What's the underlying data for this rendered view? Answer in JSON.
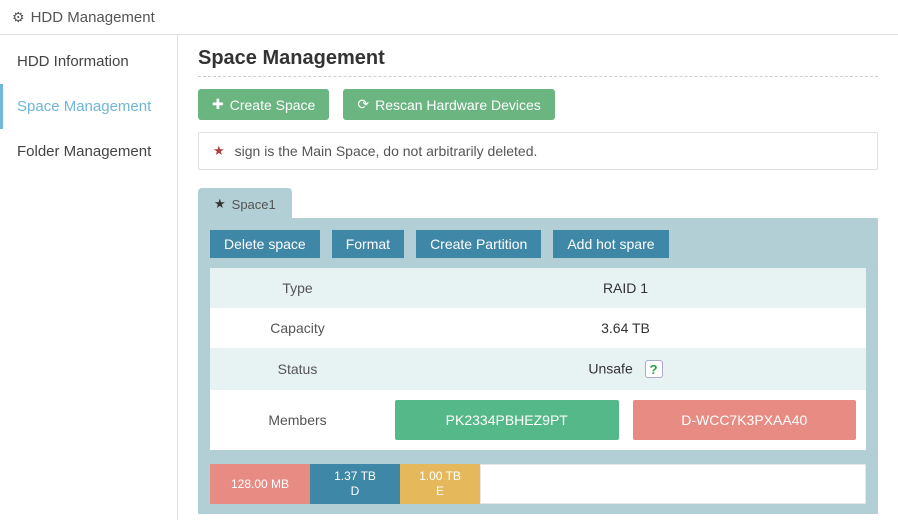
{
  "titlebar": {
    "title": "HDD Management"
  },
  "sidebar": {
    "items": [
      {
        "label": "HDD Information"
      },
      {
        "label": "Space Management"
      },
      {
        "label": "Folder Management"
      }
    ],
    "active_index": 1
  },
  "page": {
    "title": "Space Management",
    "create_label": "Create Space",
    "rescan_label": "Rescan Hardware Devices",
    "info_note": "sign is the Main Space, do not arbitrarily deleted."
  },
  "space": {
    "tab_label": "Space1",
    "buttons": {
      "delete": "Delete space",
      "format": "Format",
      "create_partition": "Create Partition",
      "add_hotspare": "Add hot spare"
    },
    "props": {
      "type_label": "Type",
      "type_value": "RAID 1",
      "capacity_label": "Capacity",
      "capacity_value": "3.64 TB",
      "status_label": "Status",
      "status_value": "Unsafe",
      "members_label": "Members"
    },
    "members": [
      {
        "id": "PK2334PBHEZ9PT",
        "state": "ok"
      },
      {
        "id": "D-WCC7K3PXAA40",
        "state": "warn"
      }
    ],
    "alloc": [
      {
        "size": "128.00 MB",
        "letter": ""
      },
      {
        "size": "1.37 TB",
        "letter": "D"
      },
      {
        "size": "1.00 TB",
        "letter": "E"
      }
    ]
  }
}
